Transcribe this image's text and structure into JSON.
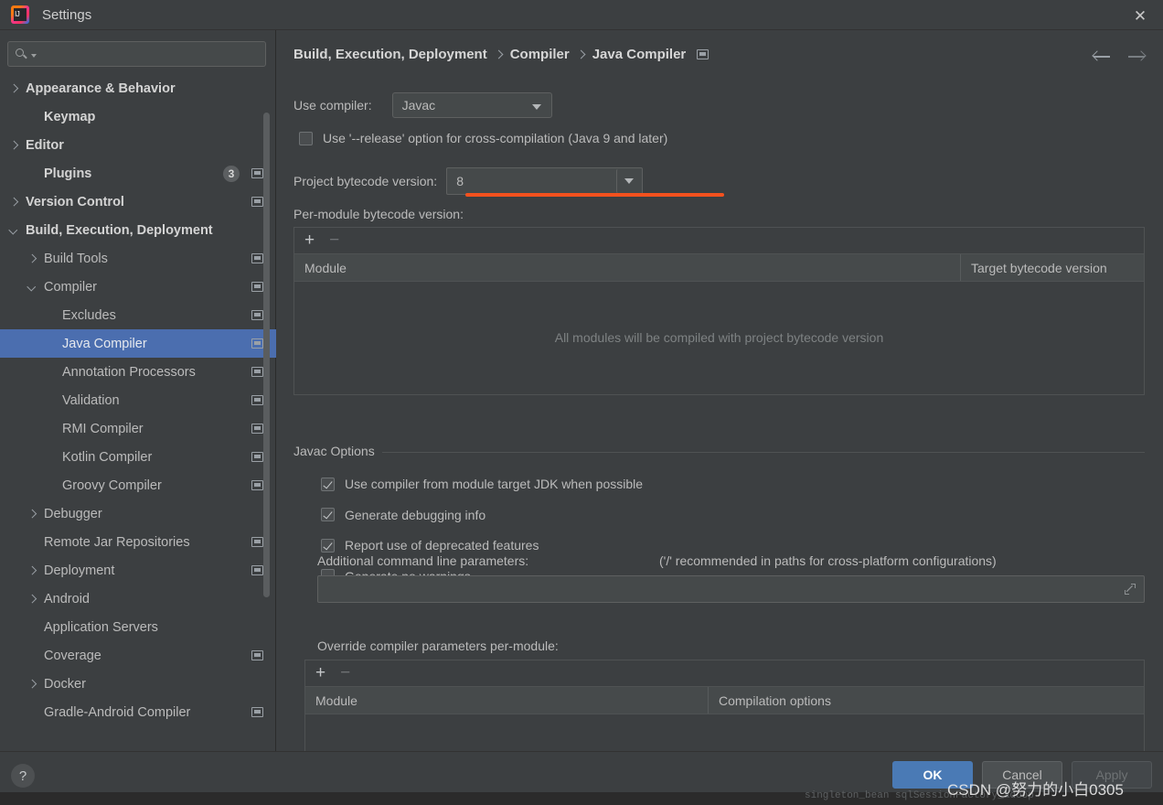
{
  "window": {
    "title": "Settings",
    "close_label": "✕",
    "logo_text": "IJ"
  },
  "sidebar": {
    "search": {
      "placeholder": "",
      "value": "",
      "icon": "search-icon"
    },
    "items": [
      {
        "label": "Appearance & Behavior",
        "arrow": "right",
        "indent": 8,
        "bold": true,
        "badge": "",
        "proj": false
      },
      {
        "label": "Keymap",
        "arrow": "none",
        "indent": 28,
        "bold": true,
        "badge": "",
        "proj": false
      },
      {
        "label": "Editor",
        "arrow": "right",
        "indent": 8,
        "bold": true,
        "badge": "",
        "proj": false
      },
      {
        "label": "Plugins",
        "arrow": "none",
        "indent": 28,
        "bold": true,
        "badge": "3",
        "proj": true
      },
      {
        "label": "Version Control",
        "arrow": "right",
        "indent": 8,
        "bold": true,
        "badge": "",
        "proj": true
      },
      {
        "label": "Build, Execution, Deployment",
        "arrow": "down",
        "indent": 8,
        "bold": true,
        "badge": "",
        "proj": false
      },
      {
        "label": "Build Tools",
        "arrow": "right",
        "indent": 28,
        "bold": false,
        "badge": "",
        "proj": true
      },
      {
        "label": "Compiler",
        "arrow": "down",
        "indent": 28,
        "bold": false,
        "badge": "",
        "proj": true
      },
      {
        "label": "Excludes",
        "arrow": "none",
        "indent": 48,
        "bold": false,
        "badge": "",
        "proj": true
      },
      {
        "label": "Java Compiler",
        "arrow": "none",
        "indent": 48,
        "bold": false,
        "badge": "",
        "proj": true,
        "selected": true
      },
      {
        "label": "Annotation Processors",
        "arrow": "none",
        "indent": 48,
        "bold": false,
        "badge": "",
        "proj": true
      },
      {
        "label": "Validation",
        "arrow": "none",
        "indent": 48,
        "bold": false,
        "badge": "",
        "proj": true
      },
      {
        "label": "RMI Compiler",
        "arrow": "none",
        "indent": 48,
        "bold": false,
        "badge": "",
        "proj": true
      },
      {
        "label": "Kotlin Compiler",
        "arrow": "none",
        "indent": 48,
        "bold": false,
        "badge": "",
        "proj": true
      },
      {
        "label": "Groovy Compiler",
        "arrow": "none",
        "indent": 48,
        "bold": false,
        "badge": "",
        "proj": true
      },
      {
        "label": "Debugger",
        "arrow": "right",
        "indent": 28,
        "bold": false,
        "badge": "",
        "proj": false
      },
      {
        "label": "Remote Jar Repositories",
        "arrow": "none",
        "indent": 28,
        "bold": false,
        "badge": "",
        "proj": true
      },
      {
        "label": "Deployment",
        "arrow": "right",
        "indent": 28,
        "bold": false,
        "badge": "",
        "proj": true
      },
      {
        "label": "Android",
        "arrow": "right",
        "indent": 28,
        "bold": false,
        "badge": "",
        "proj": false
      },
      {
        "label": "Application Servers",
        "arrow": "none",
        "indent": 28,
        "bold": false,
        "badge": "",
        "proj": false
      },
      {
        "label": "Coverage",
        "arrow": "none",
        "indent": 28,
        "bold": false,
        "badge": "",
        "proj": true
      },
      {
        "label": "Docker",
        "arrow": "right",
        "indent": 28,
        "bold": false,
        "badge": "",
        "proj": false
      },
      {
        "label": "Gradle-Android Compiler",
        "arrow": "none",
        "indent": 28,
        "bold": false,
        "badge": "",
        "proj": true
      }
    ]
  },
  "main": {
    "breadcrumb": [
      "Build, Execution, Deployment",
      "Compiler",
      "Java Compiler"
    ],
    "use_compiler_label": "Use compiler:",
    "use_compiler_value": "Javac",
    "release_option_label": "Use '--release' option for cross-compilation (Java 9 and later)",
    "release_option_checked": false,
    "bytecode_label": "Project bytecode version:",
    "bytecode_value": "8",
    "highlight_color": "#f4511e",
    "per_module_label": "Per-module bytecode version:",
    "per_module_table": {
      "add_label": "+",
      "remove_label": "−",
      "columns": [
        "Module",
        "Target bytecode version"
      ],
      "empty_text": "All modules will be compiled with project bytecode version",
      "rows": []
    },
    "javac_group_title": "Javac Options",
    "javac_options": [
      {
        "label": "Use compiler from module target JDK when possible",
        "checked": true
      },
      {
        "label": "Generate debugging info",
        "checked": true
      },
      {
        "label": "Report use of deprecated features",
        "checked": true
      },
      {
        "label": "Generate no warnings",
        "checked": false
      }
    ],
    "additional_params_label": "Additional command line parameters:",
    "additional_params_hint": "('/' recommended in paths for cross-platform configurations)",
    "additional_params_value": "",
    "override_label": "Override compiler parameters per-module:",
    "override_table": {
      "add_label": "+",
      "remove_label": "−",
      "columns": [
        "Module",
        "Compilation options"
      ],
      "rows": []
    }
  },
  "footer": {
    "help_label": "?",
    "ok_label": "OK",
    "cancel_label": "Cancel",
    "apply_label": "Apply"
  },
  "overlay": {
    "watermark": "CSDN @努力的小白0305",
    "background_code": "singleton_bean    sqlSessionFactory_adoop"
  }
}
